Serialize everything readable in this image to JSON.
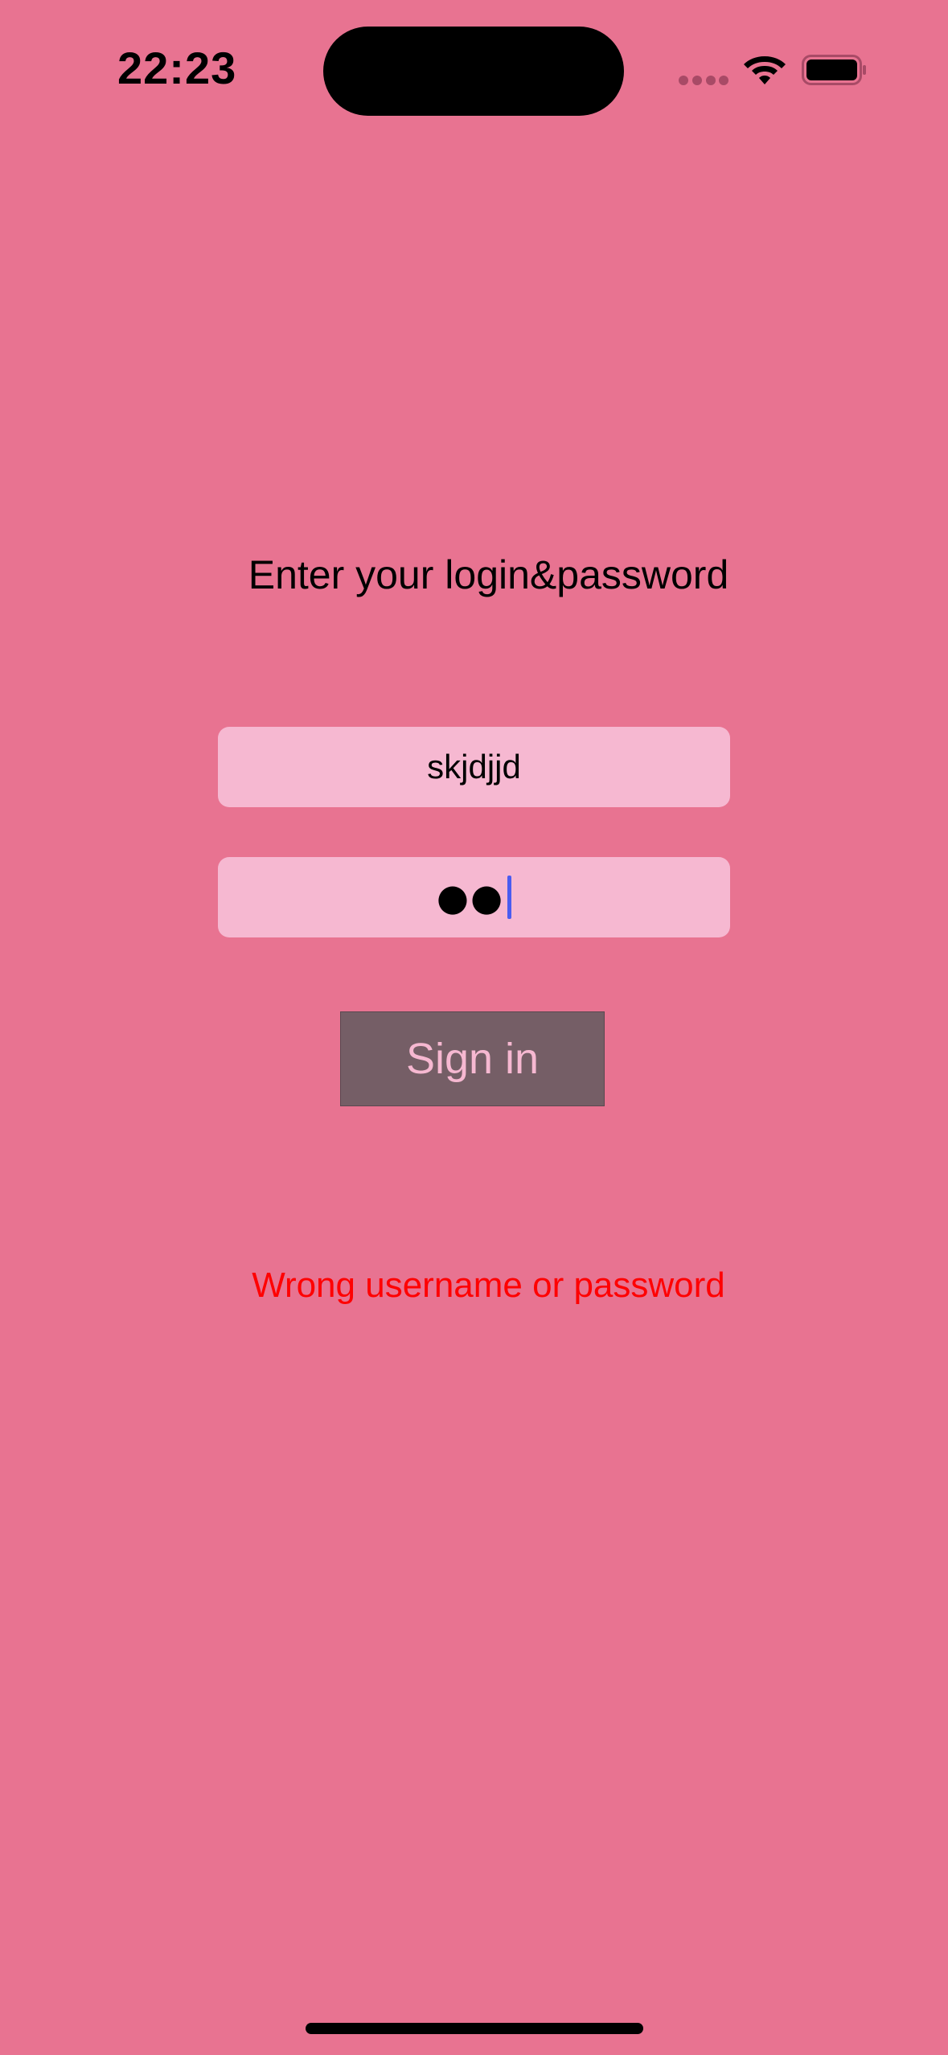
{
  "status_bar": {
    "time": "22:23",
    "icons": [
      "cellular-signal-icon",
      "wifi-icon",
      "battery-icon"
    ]
  },
  "login": {
    "prompt": "Enter your login&password",
    "username_value": "skjdjjd",
    "password_masked": "●●",
    "signin_label": "Sign in",
    "error_message": "Wrong username or password"
  },
  "colors": {
    "background": "#e87391",
    "field_background": "#f6b8d1",
    "button_background": "#755e66",
    "button_text": "#f6b8d1",
    "error_text": "#ff0000",
    "caret": "#4a5bf0"
  }
}
